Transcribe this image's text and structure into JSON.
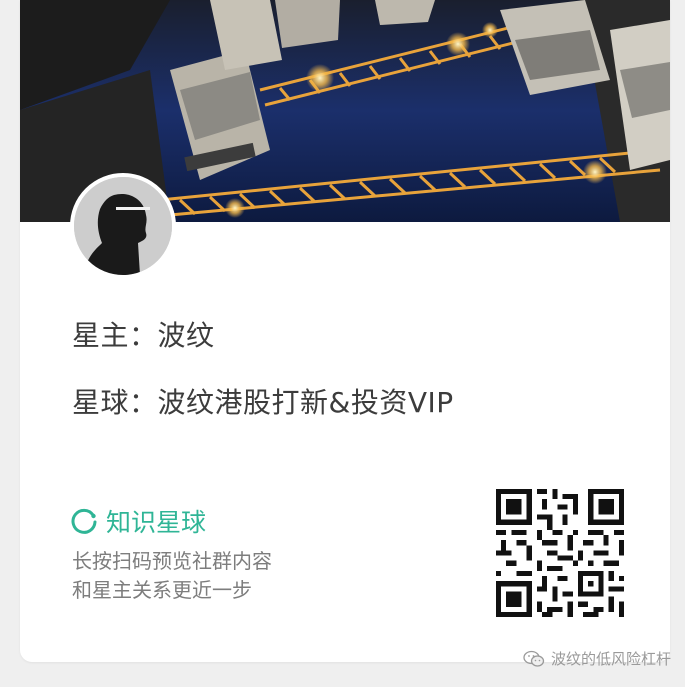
{
  "owner": {
    "label": "星主：",
    "name": "波纹"
  },
  "planet": {
    "label": "星球：",
    "name": "波纹港股打新&投资VIP"
  },
  "brand": {
    "name": "知识星球",
    "icon": "zsxq-logo-icon",
    "color": "#2fb596"
  },
  "hint": {
    "line1": "长按扫码预览社群内容",
    "line2": "和星主关系更近一步"
  },
  "watermark": {
    "text": "波纹的低风险杠杆",
    "icon": "wechat-icon"
  }
}
